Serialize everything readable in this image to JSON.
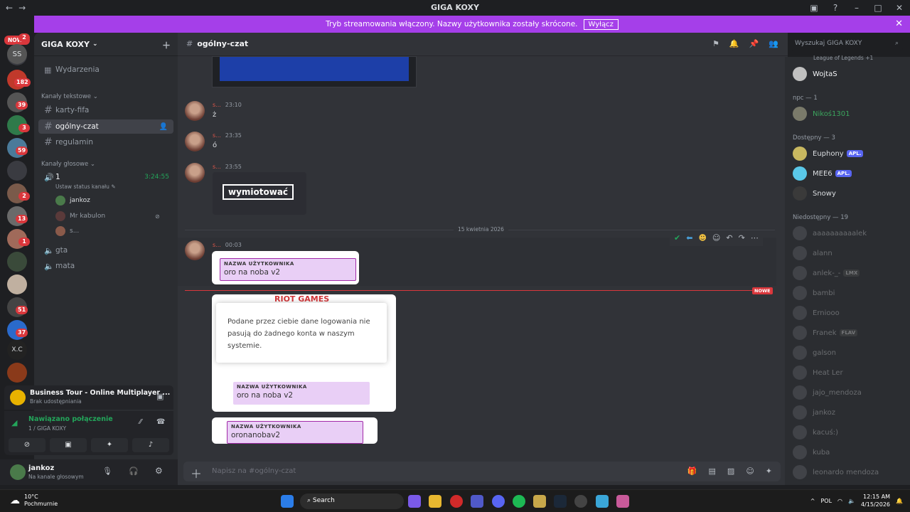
{
  "window": {
    "title": "GIGA KOXY"
  },
  "banner": {
    "text": "Tryb streamowania włączony. Nazwy użytkownika zostały skrócone.",
    "button": "Wyłącz"
  },
  "rail": {
    "nowe": "NOWE",
    "ss": "SS",
    "xc": "X.C",
    "badges": [
      "2",
      "182",
      "39",
      "3",
      "59",
      "2",
      "13",
      "1",
      "51",
      "37"
    ]
  },
  "sidebar": {
    "guild_name": "GIGA KOXY",
    "events": "Wydarzenia",
    "text_category": "Kanały tekstowe",
    "text_channels": [
      "karty-fifa",
      "ogólny-czat",
      "regulamin"
    ],
    "voice_category": "Kanały głosowe",
    "voice_channel": "1",
    "voice_timer": "3:24:55",
    "set_status": "Ustaw status kanału",
    "voice_users": [
      "jankoz",
      "Mr kabulon",
      "s..."
    ],
    "other_voice": [
      "gta",
      "mata"
    ]
  },
  "activity": {
    "title": "Business Tour - Online Multiplayer ...",
    "subtitle": "Brak udostępniania"
  },
  "voice": {
    "status": "Nawiązano połączenie",
    "server": "1 / GIGA KOXY"
  },
  "user": {
    "name": "jankoz",
    "status": "Na kanale głosowym"
  },
  "channel": {
    "name": "ogólny-czat",
    "search_placeholder": "Wyszukaj GIGA KOXY",
    "composer_placeholder": "Napisz na #ogólny-czat"
  },
  "messages": [
    {
      "author": "s...",
      "time": "23:10",
      "text": "ż"
    },
    {
      "author": "s...",
      "time": "23:35",
      "text": "ó"
    },
    {
      "author": "s...",
      "time": "23:55",
      "image_text": "wymiotować"
    }
  ],
  "divider_date": "15 kwietnia 2026",
  "new_label": "NOWE",
  "last_message": {
    "author": "s...",
    "time": "00:03"
  },
  "cards": {
    "field_label": "NAZWA UŻYTKOWNIKA",
    "value1": "oro na noba v2",
    "brand": "RIOT GAMES",
    "error": "Podane przez ciebie dane logowania nie pasują do żadnego konta w naszym systemie.",
    "value2": "oro na noba v2",
    "value3": "oronanobav2"
  },
  "members": {
    "top_activity": "League of Legends +1",
    "sections": [
      {
        "header": "npc — 1",
        "members": [
          {
            "name": "Nikoś1301",
            "color": "#3ba55d"
          }
        ]
      },
      {
        "header": "Dostępny — 3",
        "members": [
          {
            "name": "Euphony",
            "tag": "APL."
          },
          {
            "name": "MEE6",
            "tag": "APL."
          },
          {
            "name": "Snowy"
          }
        ]
      },
      {
        "header": "Niedostępny — 19",
        "members": [
          {
            "name": "aaaaaaaaaalek"
          },
          {
            "name": "alann"
          },
          {
            "name": "anlek-_-",
            "tag": "LMX"
          },
          {
            "name": "bambi"
          },
          {
            "name": "Erniooo"
          },
          {
            "name": "Franek",
            "tag": "FLAV"
          },
          {
            "name": "galson"
          },
          {
            "name": "Heat Ler"
          },
          {
            "name": "jajo_mendoza"
          },
          {
            "name": "jankoz"
          },
          {
            "name": "kacuś:)"
          },
          {
            "name": "kuba"
          },
          {
            "name": "leonardo mendoza"
          }
        ]
      }
    ],
    "first": "WojtaS"
  },
  "taskbar": {
    "temp": "10°C",
    "weather": "Pochmurnie",
    "search": "Search",
    "lang": "POL",
    "time": "12:15 AM",
    "date": "4/15/2026"
  },
  "colors": {
    "accent": "#a53fe9",
    "brand": "#5865f2",
    "danger": "#da373c",
    "online": "#23a55a"
  }
}
